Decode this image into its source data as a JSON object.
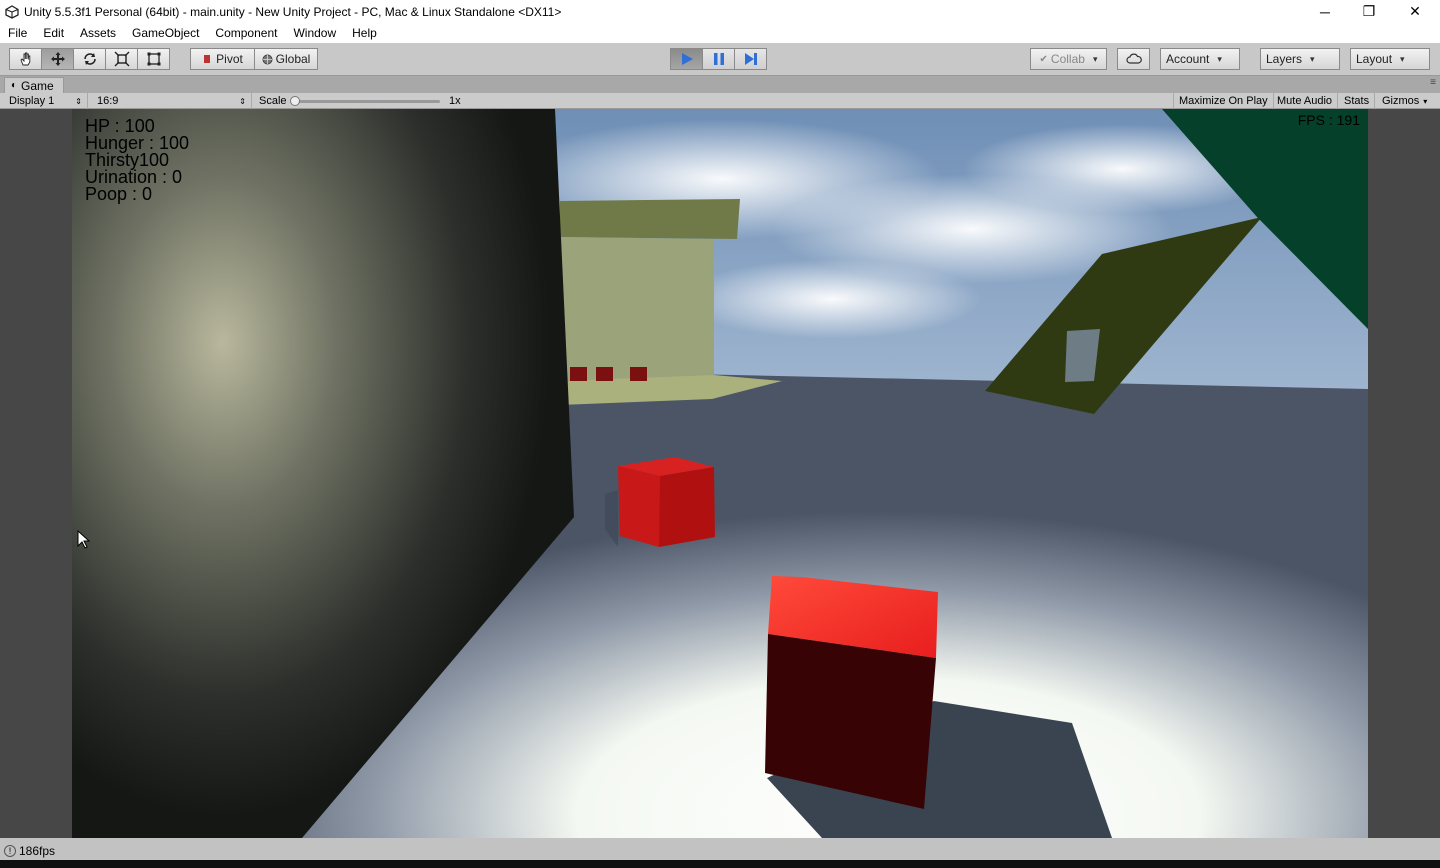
{
  "window": {
    "title": "Unity 5.5.3f1 Personal (64bit) - main.unity - New Unity Project - PC, Mac & Linux Standalone <DX11>",
    "minimize": "─",
    "restore": "❐",
    "close": "✕"
  },
  "menu": [
    "File",
    "Edit",
    "Assets",
    "GameObject",
    "Component",
    "Window",
    "Help"
  ],
  "toolbar": {
    "pivot": "Pivot",
    "global": "Global",
    "collab": "Collab",
    "account": "Account",
    "layers": "Layers",
    "layout": "Layout"
  },
  "tab": {
    "label": "Game"
  },
  "gamebar": {
    "display": "Display 1",
    "aspect": "16:9",
    "scale_label": "Scale",
    "scale_value": "1x",
    "maximize": "Maximize On Play",
    "mute": "Mute Audio",
    "stats": "Stats",
    "gizmos": "Gizmos"
  },
  "hud": {
    "hp": "HP : 100",
    "hunger": "Hunger : 100",
    "thirsty": "Thirsty100",
    "urination": "Urination : 0",
    "poop": "Poop : 0",
    "fps": "FPS : 191"
  },
  "status": {
    "fps": "186fps"
  },
  "colors": {
    "cube_red": "#e82020",
    "accent_blue": "#2f6fd6"
  }
}
